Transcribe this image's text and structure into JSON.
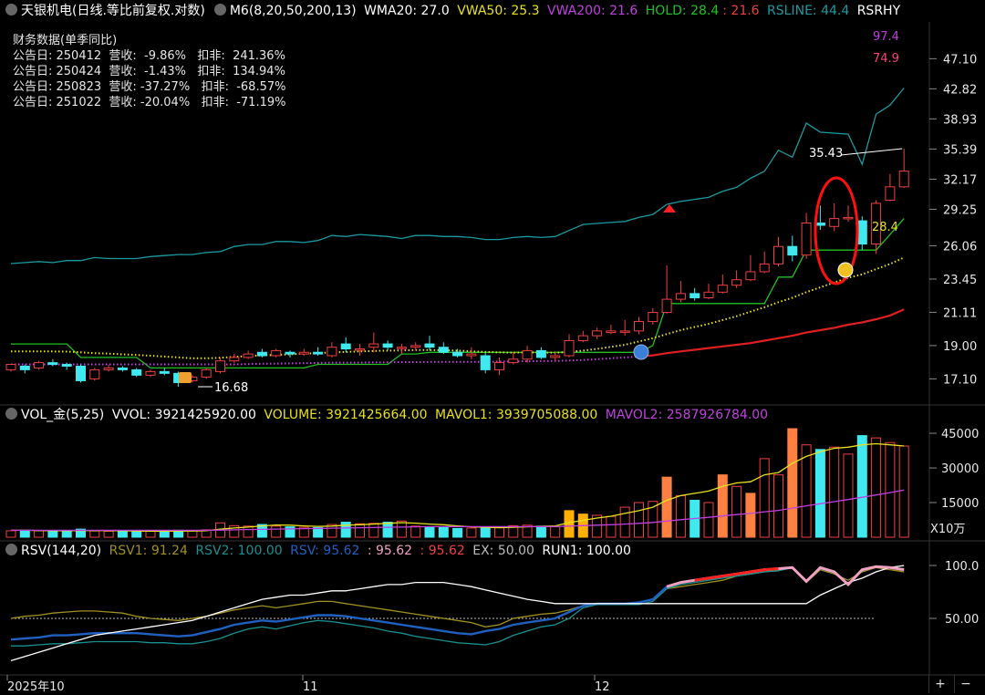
{
  "header_main": {
    "title": "天银机电(日线.等比前复权.对数)",
    "m6": "M6(8,20,50,200,13)",
    "wma20": "WMA20: 27.0",
    "vwa50": "VWA50: 25.3",
    "vwa200": "VWA200: 21.6",
    "hold_a": "HOLD: 28.4",
    "hold_b": ": 21.6",
    "rsline": "RSLINE: 44.4",
    "rsrhy": "RSRHY"
  },
  "financial": {
    "title": "财务数据(单季同比)",
    "rows": [
      "公告日: 250412  营收:  -9.86%   扣非:  241.36%",
      "公告日: 250424  营收:  -1.43%   扣非:  134.94%",
      "公告日: 250823  营收: -37.27%   扣非:  -68.57%",
      "公告日: 251022  营收: -20.04%   扣非:  -71.19%"
    ]
  },
  "header_vol": {
    "name": "VOL_金(5,25)",
    "vvol": "VVOL: 3921425920.00",
    "volume": "VOLUME: 3921425664.00",
    "mavol1": "MAVOL1: 3939705088.00",
    "mavol2": "MAVOL2: 2587926784.00"
  },
  "header_rsv": {
    "name": "RSV(144,20)",
    "rsv1": "RSV1: 91.24",
    "rsv2": "RSV2: 100.00",
    "rsv": "RSV: 95.62",
    "v1": ": 95.62",
    "v2": ": 95.62",
    "ex": "EX: 50.00",
    "run1": "RUN1: 100.00"
  },
  "buttons": {
    "plus": "+",
    "minus": "−"
  },
  "colors": {
    "up": "#f04040",
    "down": "#40e8f0",
    "rsline": "#1b9aa0",
    "wma": "#e8e020",
    "hold": "#20c020",
    "vwa200": "#c040e0",
    "vwa200_red": "#e02020",
    "mavol1": "#e8e020",
    "mavol2": "#c040e0",
    "vol_gold": "#ffb000",
    "vol_orange": "#ff8040",
    "rsv1": "#a09020",
    "rsv2": "#1a9090",
    "rsv": "#2060c0",
    "run1": "#ffffff",
    "ex": "#bbbbbb"
  },
  "chart_data": {
    "type": "candlestick",
    "price_axis": {
      "scale": "log",
      "ticks": [
        "47.10",
        "42.82",
        "38.93",
        "35.39",
        "32.17",
        "29.25",
        "26.06",
        "23.45",
        "21.11",
        "19.00",
        "17.10"
      ],
      "labels_on_chart": [
        "97.4",
        "74.9",
        "35.43",
        "28.4",
        "16.68"
      ]
    },
    "x_labels": [
      "2025年10",
      "11",
      "12"
    ],
    "candles": [
      [
        17.6,
        17.9,
        17.9,
        17.5
      ],
      [
        17.8,
        17.6,
        17.9,
        17.4
      ],
      [
        17.7,
        18.0,
        18.1,
        17.6
      ],
      [
        18.0,
        17.9,
        18.2,
        17.8
      ],
      [
        17.9,
        17.8,
        18.0,
        17.6
      ],
      [
        17.8,
        17.0,
        17.9,
        16.9
      ],
      [
        17.1,
        17.6,
        17.7,
        17.0
      ],
      [
        17.6,
        17.7,
        17.9,
        17.5
      ],
      [
        17.7,
        17.6,
        17.8,
        17.5
      ],
      [
        17.6,
        17.3,
        17.7,
        17.2
      ],
      [
        17.3,
        17.5,
        17.6,
        17.2
      ],
      [
        17.5,
        17.4,
        17.7,
        17.3
      ],
      [
        17.4,
        16.9,
        17.5,
        16.68
      ],
      [
        17.0,
        17.2,
        17.3,
        16.9
      ],
      [
        17.2,
        17.6,
        17.7,
        17.1
      ],
      [
        17.5,
        18.1,
        18.3,
        17.4
      ],
      [
        18.1,
        18.3,
        18.5,
        18.0
      ],
      [
        18.3,
        18.5,
        18.7,
        18.2
      ],
      [
        18.6,
        18.4,
        18.8,
        18.3
      ],
      [
        18.4,
        18.7,
        18.8,
        18.3
      ],
      [
        18.6,
        18.5,
        18.7,
        18.3
      ],
      [
        18.5,
        18.6,
        18.8,
        18.4
      ],
      [
        18.6,
        18.5,
        18.9,
        18.4
      ],
      [
        18.4,
        18.9,
        19.2,
        18.3
      ],
      [
        19.1,
        18.8,
        19.5,
        18.6
      ],
      [
        18.8,
        18.8,
        19.1,
        18.4
      ],
      [
        18.9,
        19.1,
        19.8,
        18.6
      ],
      [
        19.1,
        18.9,
        19.3,
        18.7
      ],
      [
        18.9,
        18.9,
        19.1,
        18.5
      ],
      [
        18.9,
        19.0,
        19.2,
        18.7
      ],
      [
        19.1,
        18.9,
        19.6,
        18.7
      ],
      [
        18.9,
        18.6,
        19.2,
        18.5
      ],
      [
        18.6,
        18.4,
        18.8,
        18.3
      ],
      [
        18.4,
        18.5,
        18.9,
        18.2
      ],
      [
        18.4,
        17.6,
        18.6,
        17.4
      ],
      [
        17.6,
        18.0,
        18.3,
        17.3
      ],
      [
        18.0,
        18.2,
        18.6,
        17.9
      ],
      [
        18.2,
        18.7,
        19.0,
        18.0
      ],
      [
        18.7,
        18.3,
        18.9,
        18.2
      ],
      [
        18.3,
        18.4,
        18.6,
        18.1
      ],
      [
        18.4,
        19.3,
        19.7,
        18.3
      ],
      [
        19.3,
        19.6,
        19.9,
        19.2
      ],
      [
        19.6,
        19.9,
        20.1,
        19.4
      ],
      [
        19.8,
        19.9,
        20.3,
        19.7
      ],
      [
        19.9,
        19.9,
        20.6,
        19.6
      ],
      [
        19.9,
        20.5,
        20.8,
        19.7
      ],
      [
        20.5,
        21.1,
        21.4,
        20.3
      ],
      [
        21.1,
        22.0,
        24.5,
        21.0
      ],
      [
        22.0,
        22.4,
        23.3,
        21.8
      ],
      [
        22.4,
        22.1,
        22.8,
        21.9
      ],
      [
        22.1,
        22.5,
        23.1,
        22.0
      ],
      [
        22.5,
        23.0,
        23.8,
        22.4
      ],
      [
        23.0,
        23.4,
        24.1,
        22.8
      ],
      [
        23.4,
        24.0,
        25.3,
        23.3
      ],
      [
        24.0,
        24.6,
        25.6,
        23.9
      ],
      [
        24.6,
        26.0,
        26.8,
        24.4
      ],
      [
        26.0,
        25.3,
        26.9,
        24.8
      ],
      [
        25.3,
        28.0,
        28.9,
        25.0
      ],
      [
        28.0,
        27.8,
        29.6,
        27.4
      ],
      [
        27.7,
        28.4,
        29.8,
        27.3
      ],
      [
        28.4,
        28.5,
        29.6,
        28.1
      ],
      [
        28.2,
        26.2,
        28.6,
        25.7
      ],
      [
        26.2,
        29.8,
        30.1,
        25.4
      ],
      [
        30.1,
        31.4,
        32.7,
        30.0
      ],
      [
        31.4,
        33.0,
        35.43,
        31.3
      ]
    ],
    "series": [
      {
        "name": "RSLINE",
        "values": [
          23.0,
          23.1,
          23.2,
          23.1,
          23.3,
          23.3,
          23.6,
          23.5,
          23.5,
          23.5,
          23.7,
          23.8,
          23.9,
          23.9,
          24.1,
          24.2,
          24.7,
          24.9,
          24.9,
          25.2,
          25.2,
          25.1,
          25.3,
          25.8,
          25.7,
          25.9,
          25.8,
          25.7,
          25.5,
          25.8,
          25.8,
          25.7,
          25.7,
          25.6,
          25.4,
          25.4,
          25.6,
          25.7,
          25.6,
          25.7,
          26.3,
          26.9,
          27.0,
          27.1,
          27.2,
          27.6,
          27.9,
          28.9,
          29.2,
          29.4,
          29.6,
          30.2,
          30.6,
          31.5,
          32.2,
          34.3,
          33.6,
          37.0,
          36.1,
          36.0,
          35.9,
          32.9,
          37.9,
          38.8,
          40.5
        ]
      },
      {
        "name": "WMA20",
        "values": [
          18.65,
          18.65,
          18.65,
          18.65,
          18.64,
          18.6,
          18.55,
          18.52,
          18.48,
          18.44,
          18.4,
          18.35,
          18.3,
          18.25,
          18.25,
          18.28,
          18.33,
          18.38,
          18.42,
          18.45,
          18.48,
          18.52,
          18.55,
          18.6,
          18.62,
          18.65,
          18.68,
          18.7,
          18.71,
          18.73,
          18.73,
          18.72,
          18.7,
          18.66,
          18.62,
          18.6,
          18.58,
          18.6,
          18.58,
          18.58,
          18.62,
          18.7,
          18.8,
          18.92,
          19.05,
          19.25,
          19.45,
          19.7,
          19.95,
          20.15,
          20.35,
          20.6,
          20.85,
          21.15,
          21.45,
          21.8,
          22.1,
          22.5,
          22.85,
          23.2,
          23.55,
          23.8,
          24.2,
          24.6,
          25.1
        ]
      },
      {
        "name": "HOLD",
        "values": [
          19.1,
          19.1,
          19.1,
          19.1,
          19.1,
          18.3,
          18.3,
          18.3,
          18.3,
          18.3,
          17.7,
          17.7,
          17.7,
          17.7,
          17.7,
          17.7,
          17.7,
          17.7,
          17.7,
          17.7,
          17.7,
          17.7,
          17.9,
          17.9,
          17.9,
          17.9,
          17.9,
          17.9,
          18.5,
          18.5,
          18.6,
          18.6,
          18.6,
          18.6,
          18.6,
          18.6,
          18.6,
          18.6,
          18.6,
          18.6,
          18.6,
          18.6,
          18.6,
          18.6,
          18.6,
          18.6,
          19.0,
          21.7,
          21.7,
          21.7,
          21.7,
          21.7,
          21.7,
          21.7,
          21.7,
          23.6,
          23.6,
          25.7,
          25.7,
          25.7,
          25.7,
          25.7,
          25.7,
          27.0,
          28.4
        ]
      },
      {
        "name": "VWA200",
        "values": [
          17.9,
          17.9,
          17.9,
          17.9,
          17.9,
          17.9,
          17.9,
          17.9,
          17.9,
          17.9,
          17.9,
          17.9,
          17.9,
          17.9,
          17.9,
          17.9,
          17.9,
          17.92,
          17.94,
          17.95,
          17.96,
          17.97,
          17.98,
          18.0,
          18.0,
          18.0,
          18.02,
          18.02,
          18.03,
          18.03,
          18.04,
          18.04,
          18.05,
          18.05,
          18.05,
          18.06,
          18.07,
          18.08,
          18.09,
          18.1,
          18.12,
          18.15,
          18.2,
          18.25,
          18.3,
          18.35,
          18.42,
          18.55,
          18.65,
          18.75,
          18.85,
          18.95,
          19.05,
          19.15,
          19.3,
          19.45,
          19.6,
          19.8,
          19.95,
          20.1,
          20.3,
          20.45,
          20.65,
          20.9,
          21.3
        ]
      }
    ],
    "volume_axis": {
      "ticks": [
        "45000",
        "30000",
        "15000"
      ],
      "unit": "X10万"
    },
    "volume": [
      3,
      3,
      3,
      3,
      3,
      3,
      3,
      3,
      3,
      3,
      3,
      3,
      3,
      3,
      3,
      5,
      6,
      5,
      4,
      4,
      4,
      4,
      4,
      5,
      6,
      6,
      6,
      6,
      6,
      5,
      5,
      5,
      4,
      4,
      4,
      4,
      4,
      4,
      4,
      4,
      8,
      8,
      8,
      8,
      8,
      9,
      10,
      10,
      10,
      10,
      10,
      10,
      10,
      10,
      10,
      10,
      10,
      10,
      10,
      10,
      10,
      10,
      10,
      10,
      10
    ],
    "vol_values": [
      2800,
      3000,
      2800,
      2600,
      2900,
      3500,
      2700,
      2600,
      2800,
      2500,
      2600,
      2700,
      3000,
      2800,
      3200,
      6200,
      5000,
      4800,
      5500,
      4800,
      4500,
      4300,
      4200,
      5500,
      6500,
      5800,
      6000,
      6500,
      7000,
      4800,
      4500,
      4200,
      3800,
      4000,
      4500,
      4200,
      5000,
      5200,
      4800,
      4500,
      11500,
      10000,
      9500,
      9000,
      13000,
      15000,
      15500,
      26000,
      18000,
      16000,
      15000,
      27000,
      22000,
      19000,
      34000,
      27000,
      47000,
      40000,
      38000,
      39000,
      36000,
      44000,
      43000,
      41000,
      39500
    ],
    "mavol1": [
      3000,
      3000,
      2900,
      2800,
      2800,
      2900,
      2900,
      2900,
      2800,
      2700,
      2600,
      2600,
      2700,
      2700,
      2800,
      3500,
      4000,
      4400,
      4900,
      5300,
      5200,
      4900,
      4700,
      4800,
      5200,
      5400,
      5700,
      6000,
      6300,
      6100,
      5700,
      5400,
      4900,
      4500,
      4300,
      4100,
      4300,
      4500,
      4700,
      4900,
      6300,
      7300,
      8300,
      9100,
      10300,
      11500,
      13000,
      16000,
      18000,
      19000,
      20000,
      22000,
      23500,
      24000,
      27000,
      28000,
      32000,
      35000,
      37000,
      38500,
      39000,
      40000,
      40500,
      40000,
      39500
    ],
    "mavol2": [
      3000,
      3000,
      3000,
      3000,
      3000,
      3000,
      3000,
      3000,
      3000,
      3000,
      3000,
      3000,
      3000,
      3000,
      3000,
      3100,
      3200,
      3300,
      3400,
      3500,
      3600,
      3700,
      3800,
      3900,
      4000,
      4100,
      4200,
      4300,
      4400,
      4500,
      4600,
      4600,
      4600,
      4600,
      4600,
      4600,
      4600,
      4600,
      4600,
      4600,
      4800,
      5000,
      5200,
      5400,
      5700,
      6000,
      6400,
      7000,
      7600,
      8100,
      8600,
      9200,
      9800,
      10300,
      11000,
      11600,
      12600,
      13600,
      14500,
      15400,
      16300,
      17300,
      18300,
      19300,
      20400
    ],
    "rsv_axis": {
      "ticks": [
        "100.0",
        "50.00"
      ]
    },
    "rsv1": [
      50,
      52,
      53,
      55,
      56,
      57,
      57,
      56,
      55,
      52,
      50,
      49,
      48,
      50,
      52,
      55,
      58,
      60,
      62,
      60,
      62,
      64,
      66,
      66,
      64,
      62,
      60,
      58,
      56,
      54,
      52,
      50,
      48,
      46,
      42,
      44,
      50,
      52,
      54,
      55,
      58,
      62,
      64,
      64,
      64,
      65,
      68,
      78,
      80,
      82,
      84,
      86,
      90,
      92,
      94,
      96,
      98,
      84,
      96,
      92,
      86,
      94,
      98,
      96,
      94
    ],
    "rsv2": [
      24,
      24,
      25,
      26,
      26,
      27,
      28,
      28,
      28,
      28,
      27,
      27,
      26,
      26,
      28,
      31,
      36,
      40,
      42,
      40,
      43,
      46,
      48,
      47,
      45,
      43,
      41,
      38,
      36,
      33,
      31,
      29,
      27,
      26,
      25,
      28,
      34,
      38,
      42,
      44,
      50,
      60,
      63,
      63,
      63,
      63,
      66,
      78,
      82,
      84,
      86,
      88,
      90,
      92,
      94,
      95,
      98,
      84,
      97,
      93,
      82,
      95,
      99,
      98,
      97
    ],
    "rsv": [
      30,
      31,
      32,
      34,
      34,
      35,
      36,
      36,
      36,
      36,
      35,
      34,
      33,
      34,
      37,
      40,
      44,
      46,
      48,
      47,
      49,
      51,
      53,
      53,
      52,
      50,
      48,
      46,
      44,
      42,
      40,
      38,
      36,
      35,
      38,
      40,
      44,
      46,
      48,
      50,
      56,
      62,
      64,
      64,
      64,
      65,
      68,
      80,
      84,
      86,
      88,
      90,
      92,
      94,
      96,
      97,
      98,
      85,
      98,
      94,
      82,
      96,
      99,
      98,
      96
    ],
    "run1": [
      10,
      14,
      18,
      22,
      26,
      30,
      34,
      36,
      38,
      40,
      42,
      44,
      46,
      48,
      52,
      56,
      60,
      64,
      68,
      70,
      72,
      72,
      74,
      76,
      76,
      78,
      80,
      82,
      82,
      84,
      84,
      84,
      82,
      80,
      77,
      74,
      71,
      68,
      66,
      64,
      64,
      64,
      64,
      64,
      64,
      64,
      64,
      64,
      64,
      64,
      64,
      64,
      64,
      64,
      64,
      64,
      64,
      64,
      72,
      78,
      84,
      88,
      94,
      98,
      100
    ],
    "ex": 50
  }
}
